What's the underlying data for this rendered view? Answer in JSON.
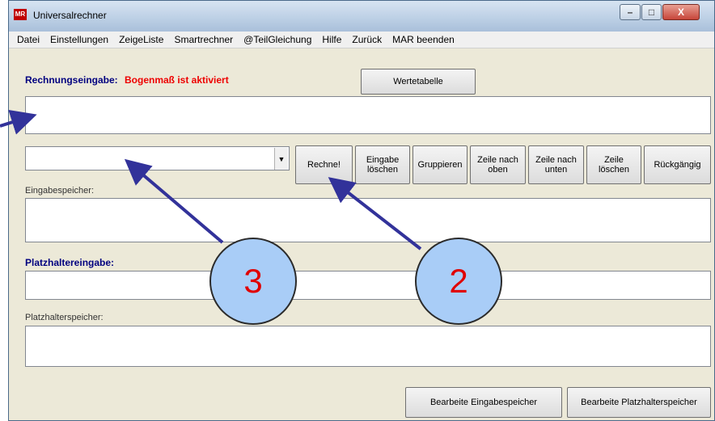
{
  "window": {
    "title": "Universalrechner",
    "app_icon_text": "MR",
    "minimize_glyph": "–",
    "maximize_glyph": "□",
    "close_glyph": "X"
  },
  "menu": [
    "Datei",
    "Einstellungen",
    "ZeigeListe",
    "Smartrechner",
    "@TeilGleichung",
    "Hilfe",
    "Zurück",
    "MAR beenden"
  ],
  "input_section": {
    "label": "Rechnungseingabe:",
    "status": "Bogenmaß ist aktiviert",
    "value_table_button": "Wertetabelle",
    "input_value": ""
  },
  "combo": {
    "value": "",
    "arrow": "▼"
  },
  "action_buttons": {
    "calculate": "Rechne!",
    "clear_input_1": "Eingabe",
    "clear_input_2": "löschen",
    "group": "Gruppieren",
    "row_up_1": "Zeile nach",
    "row_up_2": "oben",
    "row_down_1": "Zeile nach",
    "row_down_2": "unten",
    "delete_row_1": "Zeile",
    "delete_row_2": "löschen",
    "undo": "Rückgängig"
  },
  "memory_section": {
    "label": "Eingabespeicher:"
  },
  "placeholder_section": {
    "label": "Platzhaltereingabe:",
    "memory_label": "Platzhalterspeicher:"
  },
  "bottom_buttons": {
    "edit_input_memory": "Bearbeite Eingabespeicher",
    "edit_placeholder_memory": "Bearbeite Platzhalterspeicher"
  },
  "annotations": {
    "bubble_a": "3",
    "bubble_b": "2"
  },
  "colors": {
    "arrow": "#32329a",
    "bubble_fill": "#a9cdf7",
    "bubble_text": "#e00000",
    "label_blue": "#00007f",
    "label_red": "#ee0000"
  }
}
